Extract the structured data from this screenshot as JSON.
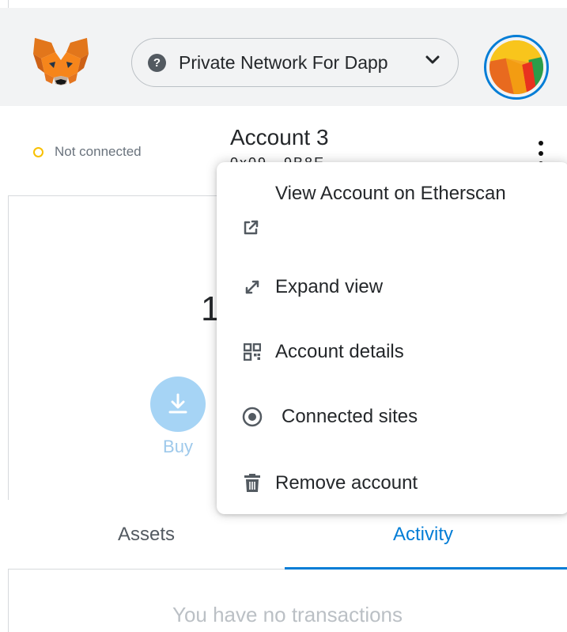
{
  "header": {
    "logo_icon": "metamask-fox-icon",
    "network": {
      "label": "Private Network For Dapp",
      "icon": "question-mark-icon",
      "icon_glyph": "?",
      "chevron_icon": "chevron-down-icon"
    },
    "avatar_icon": "account-identicon"
  },
  "account": {
    "connection_status": "Not connected",
    "name": "Account 3",
    "address": "0x09...9B8E",
    "menu_button_icon": "kebab-menu-icon"
  },
  "balance": {
    "amount": "1"
  },
  "actions": {
    "buy_label": "Buy",
    "buy_icon": "download-icon"
  },
  "tabs": [
    {
      "label": "Assets",
      "active": false
    },
    {
      "label": "Activity",
      "active": true
    }
  ],
  "activity": {
    "empty_message": "You have no transactions"
  },
  "account_menu": {
    "items": [
      {
        "label": "View Account on Etherscan",
        "icon": "external-link-icon"
      },
      {
        "label": "Expand view",
        "icon": "expand-icon"
      },
      {
        "label": "Account details",
        "icon": "qr-code-icon"
      },
      {
        "label": "Connected sites",
        "icon": "connected-sites-icon"
      },
      {
        "label": "Remove account",
        "icon": "trash-icon"
      }
    ]
  },
  "colors": {
    "accent": "#037dd6",
    "header_bg": "#f2f3f4",
    "status_warning": "#f8c000",
    "buy_button": "#a6d4f5"
  }
}
